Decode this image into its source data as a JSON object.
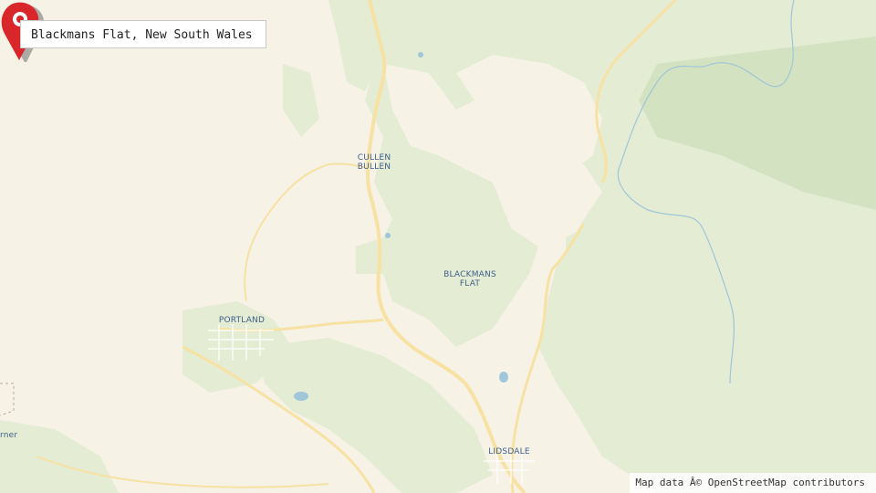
{
  "map": {
    "title": "Blackmans Flat, New South Wales",
    "attribution": "Map data Â© OpenStreetMap contributors",
    "places": {
      "cullen_bullen": "CULLEN\nBULLEN",
      "blackmans_flat": "BLACKMANS\nFLAT",
      "portland": "PORTLAND",
      "lidsdale": "LIDSDALE",
      "edge_label": "rner"
    },
    "marker": {
      "icon": "map-pin-icon",
      "color": "#d9262b"
    },
    "colors": {
      "land": "#f6f2e6",
      "forest": "#e4ecd4",
      "forest_dark": "#d3e2c0",
      "road": "#f7e2a4",
      "water": "#9fc6d9",
      "label": "#3f5f8a"
    }
  }
}
